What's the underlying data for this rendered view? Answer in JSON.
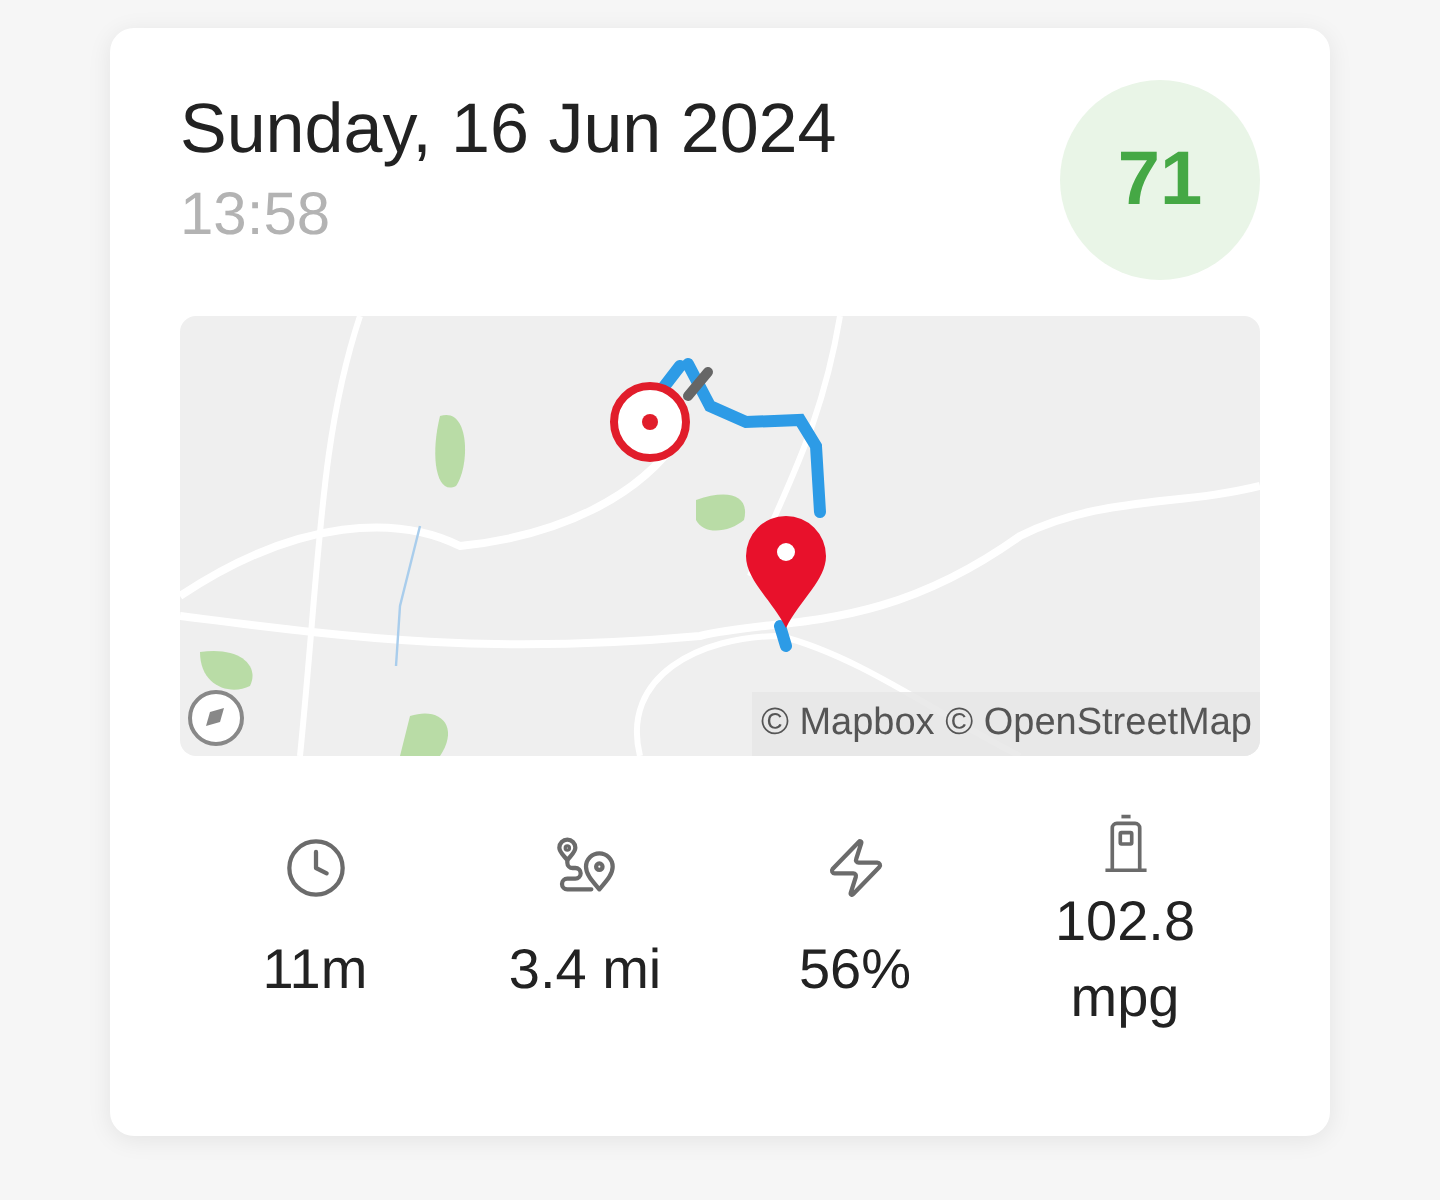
{
  "trip": {
    "date": "Sunday, 16 Jun 2024",
    "time": "13:58",
    "score": "71"
  },
  "map": {
    "attribution": "© Mapbox © OpenStreetMap"
  },
  "stats": [
    {
      "kind": "duration",
      "value": "11m"
    },
    {
      "kind": "distance",
      "value": "3.4 mi"
    },
    {
      "kind": "battery",
      "value": "56%"
    },
    {
      "kind": "efficiency",
      "value": "102.8 mpg"
    }
  ]
}
